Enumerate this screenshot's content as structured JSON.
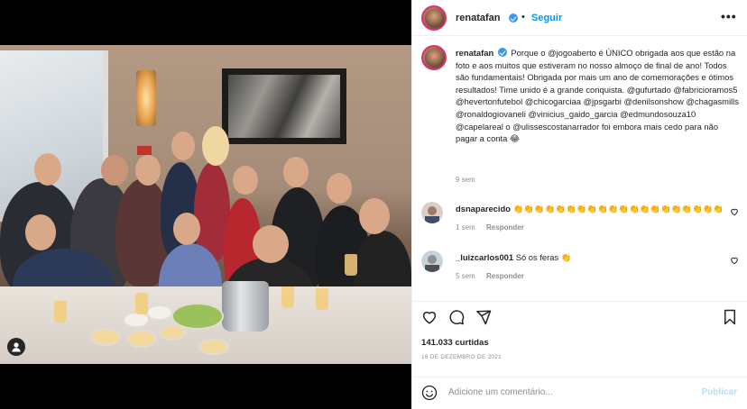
{
  "post": {
    "username": "renatafan",
    "separator": "•",
    "follow_label": "Seguir",
    "more_icon": "more-horizontal-icon",
    "more_label": "•••"
  },
  "caption": {
    "username": "renatafan",
    "text": "Porque o @jogoaberto é ÚNICO obrigada aos que estão na foto e aos muitos que estiveram no nosso almoço de final de ano! Todos são fundamentais! Obrigada por mais um ano de comemorações e ótimos resultados! Time unido é a grande conquista. @gufurtado @fabricioramos5 @hevertonfutebol @chicogarciaa @jpsgarbi @denilsonshow @chagasmills @ronaldogiovaneli @vinicius_gaido_garcia @edmundosouza10 @capelareal o @ulissescostanarrador foi embora mais cedo para não pagar a conta 😂",
    "time": "9 sem"
  },
  "comments": [
    {
      "username": "dsnaparecido",
      "text": "👏👏👏👏👏👏👏👏👏👏👏👏👏👏👏👏👏👏👏👏",
      "time": "1 sem",
      "reply": "Responder"
    },
    {
      "username": "_luizcarlos001",
      "text": "Só os feras 👏",
      "time": "5 sem",
      "reply": "Responder"
    }
  ],
  "actions": {
    "like_icon": "heart-icon",
    "comment_icon": "comment-icon",
    "share_icon": "share-icon",
    "save_icon": "bookmark-icon",
    "likes": "141.033 curtidas",
    "date": "16 DE DEZEMBRO DE 2021"
  },
  "add_comment": {
    "emoji_icon": "smiley-icon",
    "placeholder": "Adicione um comentário...",
    "post_label": "Publicar"
  },
  "colors": {
    "accent": "#0095f6",
    "verified": "#3897f0",
    "muted": "#8e8e8e",
    "story_ring": "#e1306c"
  }
}
